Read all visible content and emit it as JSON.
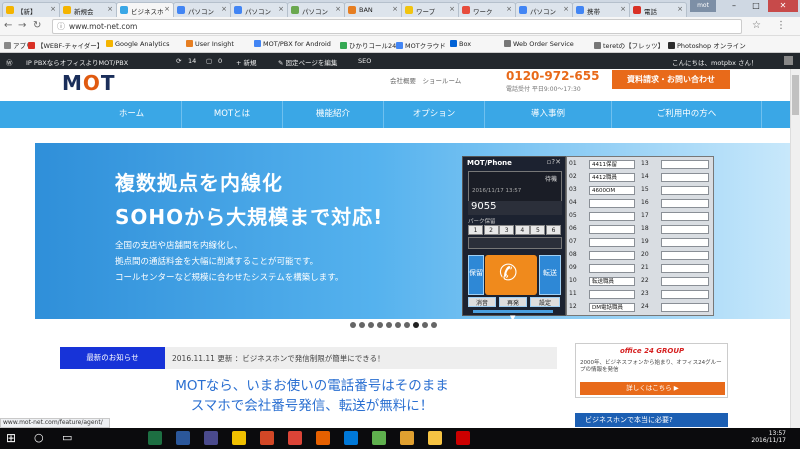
{
  "browser": {
    "tabs": [
      {
        "label": "【新】",
        "color": "#f4b400"
      },
      {
        "label": "新規会",
        "color": "#f4b400"
      },
      {
        "label": "ビジネスホ",
        "color": "#3aa7e6"
      },
      {
        "label": "パソコン",
        "color": "#4285f4"
      },
      {
        "label": "パソコン",
        "color": "#4285f4"
      },
      {
        "label": "パソコン",
        "color": "#6aa84f"
      },
      {
        "label": "BAN",
        "color": "#e67e22"
      },
      {
        "label": "ワープ",
        "color": "#f1c40f"
      },
      {
        "label": "ワーク",
        "color": "#e74c3c"
      },
      {
        "label": "パソコン",
        "color": "#4285f4"
      },
      {
        "label": "携帯",
        "color": "#4285f4"
      },
      {
        "label": "電話",
        "color": "#d93025"
      }
    ],
    "window_label": "mot",
    "url": "www.mot-net.com",
    "bookmarks": [
      {
        "label": "アプリ",
        "color": "#888"
      },
      {
        "label": "【WEBF-チャイダー】",
        "color": "#d93025"
      },
      {
        "label": "Google Analytics",
        "color": "#f4b400"
      },
      {
        "label": "User Insight",
        "color": "#e67e22"
      },
      {
        "label": "MOT/PBX for Android",
        "color": "#4285f4"
      },
      {
        "label": "ひかりコール24",
        "color": "#34a853"
      },
      {
        "label": "MOTクラウド",
        "color": "#4285f4"
      },
      {
        "label": "Box",
        "color": "#0061d5"
      },
      {
        "label": "Web Order Service",
        "color": "#777"
      },
      {
        "label": "teretの【フレッツ】",
        "color": "#777"
      },
      {
        "label": "Photoshop オンライン",
        "color": "#2c2c2c"
      }
    ]
  },
  "wpbar": {
    "site": "IP PBXならオフィスよりMOT/PBX",
    "updates": "14",
    "comments": "0",
    "new": "新規",
    "edit": "固定ページを編集",
    "seo": "SEO",
    "greeting": "こんにちは、motpbx さん！"
  },
  "header": {
    "logo_text_1": "M",
    "logo_text_2": "O",
    "logo_text_3": "T",
    "links": "会社概要　ショールーム",
    "phone": "0120-972-655",
    "hours": "電話受付 平日9:00〜17:30",
    "cta": "資料請求・お問い合わせ"
  },
  "nav": [
    "ホーム",
    "MOTとは",
    "機能紹介",
    "オプション",
    "導入事例",
    "ご利用中の方へ"
  ],
  "hero": {
    "headline1": "複数拠点を内線化",
    "headline2": "SOHOから大規模まで対応!",
    "line1": "全国の支店や店舗間を内線化し、",
    "line2": "拠点間の通話料金を大幅に削減することが可能です。",
    "line3": "コールセンターなど規模に合わせたシステムを構築します。",
    "slide_count": 10,
    "active_slide": 8
  },
  "widget": {
    "title": "MOT/Phone",
    "status": "待機",
    "datetime": "2016/11/17 13:57",
    "number": "9055",
    "park_label": "パーク保留",
    "park": [
      "1",
      "2",
      "3",
      "4",
      "5",
      "6"
    ],
    "btn_hold": "保留",
    "btn_transfer": "転送",
    "btn_mute": "消音",
    "btn_redial": "再発",
    "btn_set": "設定"
  },
  "extensions": [
    {
      "n": "01",
      "label": "4411保留"
    },
    {
      "n": "02",
      "label": "4412職員"
    },
    {
      "n": "03",
      "label": "4600OM"
    },
    {
      "n": "04",
      "label": ""
    },
    {
      "n": "05",
      "label": ""
    },
    {
      "n": "06",
      "label": ""
    },
    {
      "n": "07",
      "label": ""
    },
    {
      "n": "08",
      "label": ""
    },
    {
      "n": "09",
      "label": ""
    },
    {
      "n": "10",
      "label": "転送職員"
    },
    {
      "n": "11",
      "label": ""
    },
    {
      "n": "12",
      "label": "DM電話職員"
    }
  ],
  "extensions_right": [
    "13",
    "14",
    "15",
    "16",
    "17",
    "18",
    "19",
    "20",
    "21",
    "22",
    "23",
    "24"
  ],
  "news": {
    "badge": "最新のお知らせ",
    "date": "2016.11.11 更新",
    "text": "ビジネスホンで発信制限が簡単にできる！"
  },
  "bigtext": {
    "line1": "MOTなら、いまお使いの電話番号はそのまま",
    "line2": "スマホで会社番号発信、転送が無料に！"
  },
  "ads": {
    "ad1_brand": "office 24 GROUP",
    "ad1_text": "2000年、ビジネスフォンから始まり、オフィス24グループの情報を発信",
    "ad1_button": "詳しくはこちら ▶",
    "ad2_text": "ビジネスホンで本当に必要?"
  },
  "status_url": "www.mot-net.com/feature/agent/",
  "taskbar": {
    "time": "13:57",
    "date": "2016/11/17",
    "apps": [
      {
        "name": "windows",
        "color": "#0b0b0d"
      },
      {
        "name": "search",
        "color": "#0b0b0d"
      },
      {
        "name": "task-view",
        "color": "#0b0b0d"
      },
      {
        "name": "excel",
        "color": "#1d6f42"
      },
      {
        "name": "word",
        "color": "#2b579a"
      },
      {
        "name": "explorer",
        "color": "#4a4a8c"
      },
      {
        "name": "mot",
        "color": "#f0c000"
      },
      {
        "name": "powerpoint",
        "color": "#d24726"
      },
      {
        "name": "chrome",
        "color": "#db4437"
      },
      {
        "name": "firefox",
        "color": "#e66000"
      },
      {
        "name": "outlook",
        "color": "#0078d7"
      },
      {
        "name": "tool",
        "color": "#5fb04e"
      },
      {
        "name": "photo",
        "color": "#e0a030"
      },
      {
        "name": "folder",
        "color": "#f6c343"
      },
      {
        "name": "acrobat",
        "color": "#cc0000"
      }
    ]
  }
}
